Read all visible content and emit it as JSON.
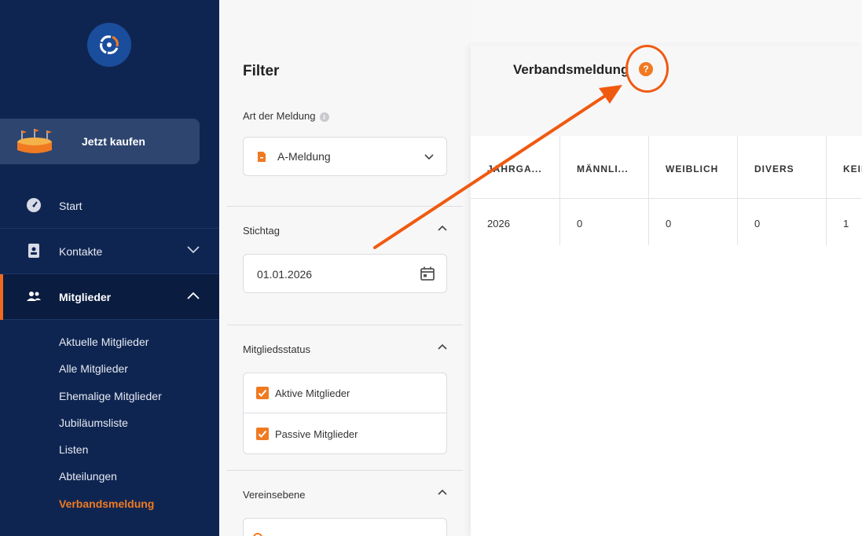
{
  "sidebar": {
    "buy_label": "Jetzt kaufen",
    "nav": [
      {
        "label": "Start"
      },
      {
        "label": "Kontakte"
      },
      {
        "label": "Mitglieder"
      }
    ],
    "sub_items": [
      "Aktuelle Mitglieder",
      "Alle Mitglieder",
      "Ehemalige Mitglieder",
      "Jubiläumsliste",
      "Listen",
      "Abteilungen",
      "Verbandsmeldung"
    ],
    "active_sub": "Verbandsmeldung"
  },
  "filter": {
    "title": "Filter",
    "report_type_label": "Art der Meldung",
    "report_type_value": "A-Meldung",
    "date_section": "Stichtag",
    "date_value": "01.01.2026",
    "status_section": "Mitgliedsstatus",
    "status_options": [
      "Aktive Mitglieder",
      "Passive Mitglieder"
    ],
    "level_section": "Vereinsebene"
  },
  "main": {
    "title": "Verbandsmeldung",
    "help_glyph": "?",
    "columns": [
      "JAHRGA...",
      "MÄNNLI...",
      "WEIBLICH",
      "DIVERS",
      "KEIN"
    ],
    "rows": [
      [
        "2026",
        "0",
        "0",
        "0",
        "1"
      ]
    ]
  },
  "colors": {
    "accent": "#f07a22",
    "sidebar": "#0f2551",
    "annotation": "#f05a10"
  }
}
